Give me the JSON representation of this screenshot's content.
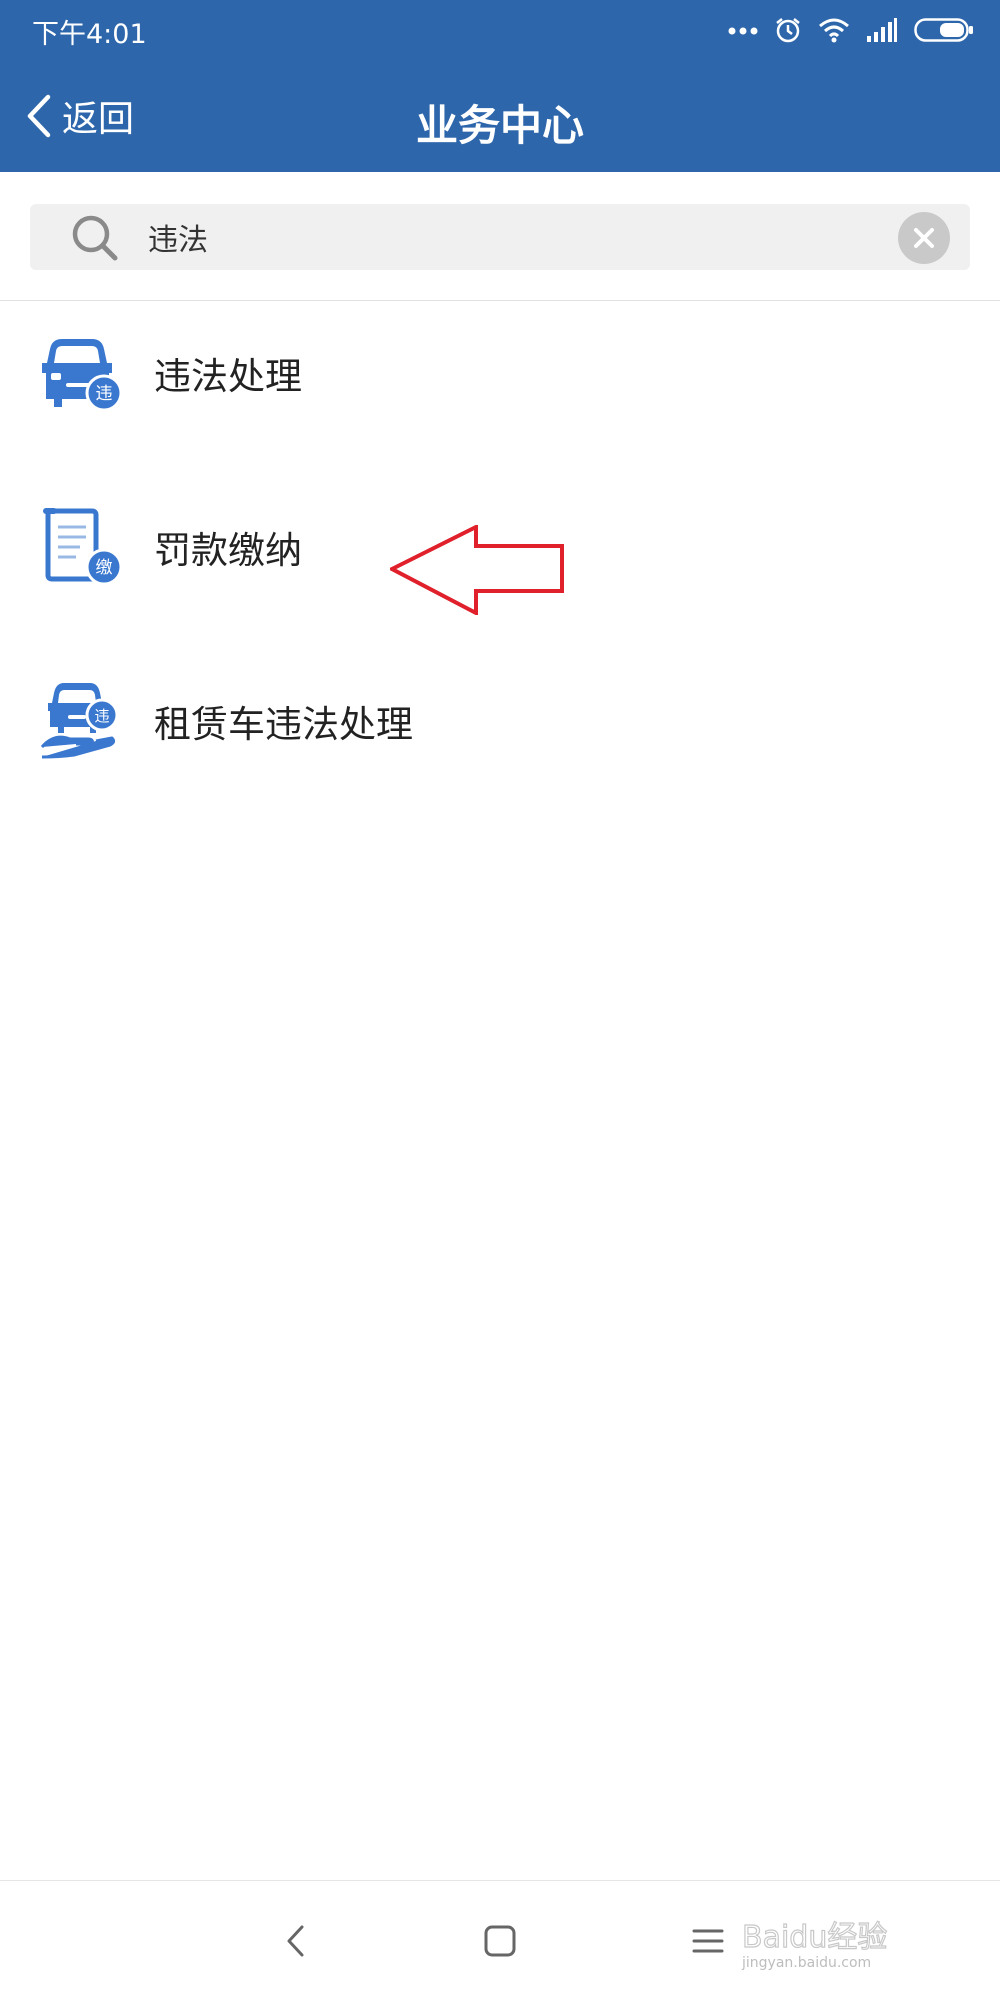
{
  "status_bar": {
    "time": "下午4:01",
    "icons": [
      "more-dots-icon",
      "alarm-icon",
      "wifi-icon",
      "signal-icon",
      "battery-icon"
    ]
  },
  "header": {
    "back_label": "返回",
    "title": "业务中心",
    "background_color": "#2d66ab"
  },
  "search": {
    "value": "违法",
    "icon": "search-icon",
    "clear_icon": "clear-icon"
  },
  "results": [
    {
      "label": "违法处理",
      "icon": "car-violation-icon",
      "badge": "违"
    },
    {
      "label": "罚款缴纳",
      "icon": "fine-payment-icon",
      "badge": "缴"
    },
    {
      "label": "租赁车违法处理",
      "icon": "rental-car-violation-icon",
      "badge": "违"
    }
  ],
  "annotation": {
    "icon": "red-arrow-icon",
    "color": "#e0202a"
  },
  "nav_bar": {
    "buttons": [
      "nav-back-icon",
      "nav-home-icon",
      "nav-menu-icon"
    ],
    "watermark_text": "Baidu经验",
    "watermark_url": "jingyan.baidu.com"
  }
}
